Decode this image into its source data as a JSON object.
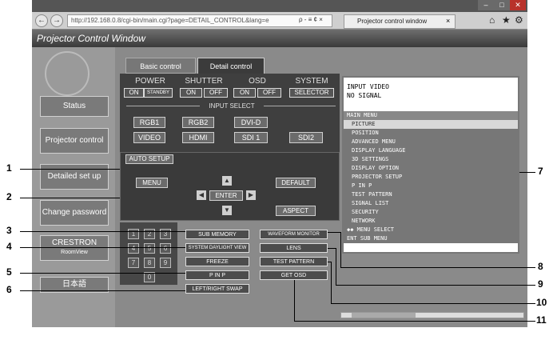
{
  "browser": {
    "url": "http://192.168.0.8/cgi-bin/main.cgi?page=DETAIL_CONTROL&lang=e",
    "tab_title": "Projector control window",
    "search_hint": "ρ - ≡ ¢ ×",
    "close_tab": "×",
    "home_icon": "⌂",
    "star_icon": "★",
    "gear_icon": "⚙",
    "back_glyph": "←",
    "forward_glyph": "→",
    "win_min": "–",
    "win_max": "□",
    "win_close": "✕"
  },
  "app": {
    "title": "Projector Control Window"
  },
  "sidebar": {
    "status": "Status",
    "projector_control": "Projector control",
    "detailed_setup": "Detailed set up",
    "change_password": "Change password",
    "crestron": "CRESTRON",
    "crestron_sub": "RoomView",
    "language": "日本語"
  },
  "tabs": {
    "basic": "Basic control",
    "detail": "Detail control"
  },
  "groups": {
    "power": {
      "label": "POWER",
      "on": "ON",
      "standby": "STANDBY"
    },
    "shutter": {
      "label": "SHUTTER",
      "on": "ON",
      "off": "OFF"
    },
    "osd": {
      "label": "OSD",
      "on": "ON",
      "off": "OFF"
    },
    "system": {
      "label": "SYSTEM",
      "selector": "SELECTOR"
    }
  },
  "input_select": {
    "label": "INPUT SELECT",
    "buttons": [
      "RGB1",
      "RGB2",
      "DVI-D",
      "VIDEO",
      "HDMI",
      "SDI 1",
      "SDI2"
    ]
  },
  "controls": {
    "auto_setup": "AUTO SETUP",
    "menu": "MENU",
    "default": "DEFAULT",
    "enter": "ENTER",
    "aspect": "ASPECT",
    "up": "▲",
    "down": "▼",
    "left": "◀",
    "right": "▶"
  },
  "numpad": [
    "1",
    "2",
    "3",
    "4",
    "5",
    "6",
    "7",
    "8",
    "9",
    "0"
  ],
  "function_buttons": {
    "sub_memory": "SUB MEMORY",
    "system_daylight_view": "SYSTEM DAYLIGHT VIEW",
    "freeze": "FREEZE",
    "pinp": "P IN P",
    "left_right_swap": "LEFT/RIGHT SWAP",
    "waveform_monitor": "WAVEFORM MONITOR",
    "lens": "LENS",
    "test_pattern": "TEST PATTERN",
    "get_osd": "GET OSD"
  },
  "osd_display": {
    "line1": "INPUT VIDEO",
    "line2": "NO SIGNAL",
    "menu_header": "MAIN MENU",
    "items": [
      "PICTURE",
      "POSITION",
      "ADVANCED MENU",
      "DISPLAY LANGUAGE",
      "3D SETTINGS",
      "DISPLAY OPTION",
      "PROJECTOR SETUP",
      "P IN P",
      "TEST PATTERN",
      "SIGNAL LIST",
      "SECURITY",
      "NETWORK"
    ],
    "footer1": "◆◆ MENU SELECT",
    "footer2": "ENT SUB MENU"
  },
  "callouts": [
    "1",
    "2",
    "3",
    "4",
    "5",
    "6",
    "7",
    "8",
    "9",
    "10",
    "11"
  ],
  "colors": {
    "app_bg": "#8a8a8a",
    "panel_bg": "#3c3c3c",
    "menu_highlight": "#d8d8d8",
    "menu_bg": "#777777"
  }
}
